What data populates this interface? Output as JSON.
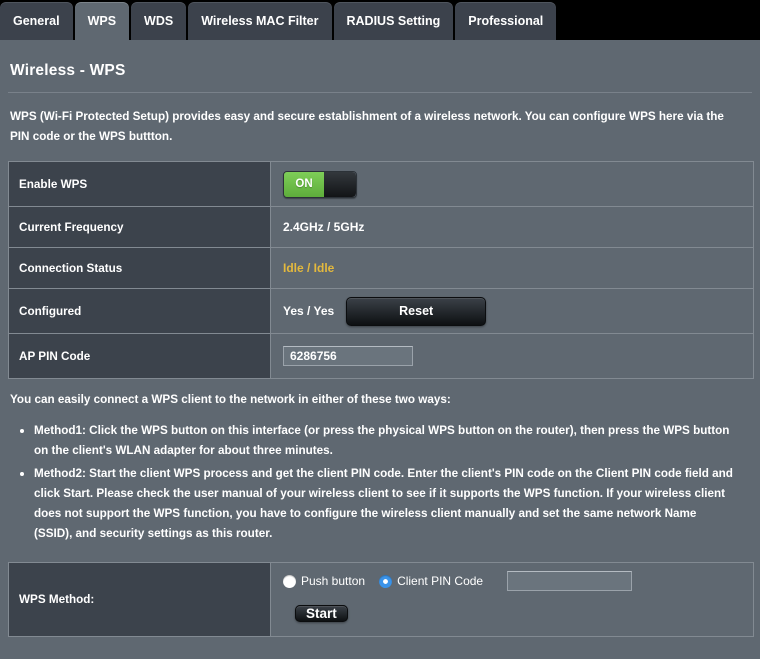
{
  "tabs": [
    {
      "label": "General",
      "active": false
    },
    {
      "label": "WPS",
      "active": true
    },
    {
      "label": "WDS",
      "active": false
    },
    {
      "label": "Wireless MAC Filter",
      "active": false
    },
    {
      "label": "RADIUS Setting",
      "active": false
    },
    {
      "label": "Professional",
      "active": false
    }
  ],
  "page": {
    "title": "Wireless - WPS",
    "intro": "WPS (Wi-Fi Protected Setup) provides easy and secure establishment of a wireless network. You can configure WPS here via the PIN code or the WPS buttton."
  },
  "settings": {
    "enable_wps": {
      "label": "Enable WPS",
      "toggle_state": "ON"
    },
    "current_frequency": {
      "label": "Current Frequency",
      "value": "2.4GHz / 5GHz"
    },
    "connection_status": {
      "label": "Connection Status",
      "value": "Idle / Idle",
      "color": "#e4b93d"
    },
    "configured": {
      "label": "Configured",
      "value": "Yes / Yes",
      "reset_label": "Reset"
    },
    "ap_pin_code": {
      "label": "AP PIN Code",
      "value": "6286756"
    }
  },
  "instructions": {
    "heading": "You can easily connect a WPS client to the network in either of these two ways:",
    "items": [
      "Method1: Click the WPS button on this interface (or press the physical WPS button on the router), then press the WPS button on the client's WLAN adapter for about three minutes.",
      "Method2: Start the client WPS process and get the client PIN code. Enter the client's PIN code on the Client PIN code field and click Start. Please check the user manual of your wireless client to see if it supports the WPS function. If your wireless client does not support the WPS function, you have to configure the wireless client manually and set the same network Name (SSID), and security settings as this router."
    ]
  },
  "wps_method": {
    "label": "WPS Method:",
    "options": [
      {
        "label": "Push button",
        "selected": false
      },
      {
        "label": "Client PIN Code",
        "selected": true
      }
    ],
    "client_pin_value": "",
    "start_label": "Start"
  },
  "colors": {
    "panel_bg": "#5f6871",
    "label_bg": "#3c434c",
    "toggle_green": "#6dc24a",
    "radio_blue": "#3b93e8",
    "status_yellow": "#e4b93d"
  }
}
